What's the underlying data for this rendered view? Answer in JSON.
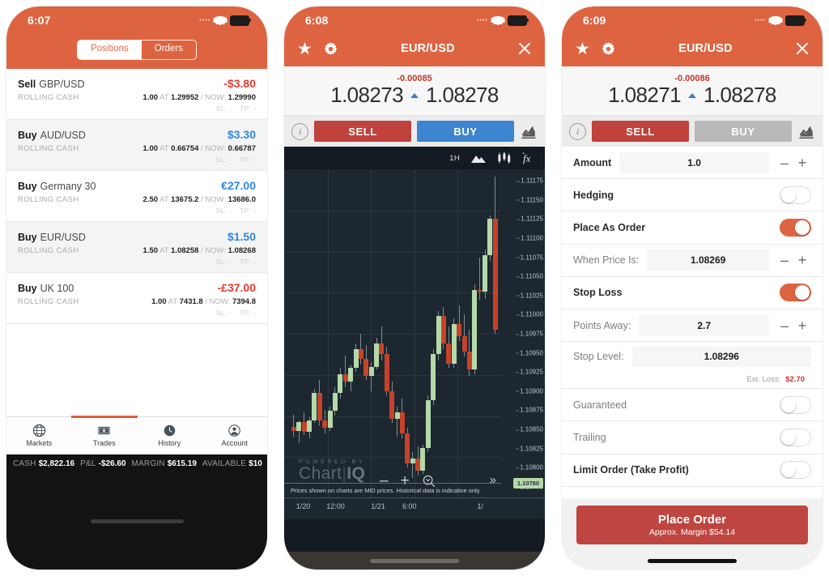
{
  "phone1": {
    "status_bar": {
      "time": "6:07",
      "dots": "••••",
      "wifi_icon": "wifi-icon",
      "battery_icon": "battery-icon"
    },
    "segmented": {
      "positions": "Positions",
      "orders": "Orders",
      "selected": "Positions"
    },
    "positions": [
      {
        "direction": "Sell",
        "instrument": "GBP/USD",
        "type": "ROLLING CASH",
        "pl": "-$3.80",
        "pl_sign": "neg",
        "size": "1.00",
        "at_label": "AT",
        "open": "1.29952",
        "now_label": "/ NOW:",
        "now": "1.29990",
        "sl": "SL: -",
        "tp": "TP: -"
      },
      {
        "direction": "Buy",
        "instrument": "AUD/USD",
        "type": "ROLLING CASH",
        "pl": "$3.30",
        "pl_sign": "pos",
        "size": "1.00",
        "at_label": "AT",
        "open": "0.66754",
        "now_label": "/ NOW:",
        "now": "0.66787",
        "sl": "SL: -",
        "tp": "TP: -"
      },
      {
        "direction": "Buy",
        "instrument": "Germany 30",
        "type": "ROLLING CASH",
        "pl": "€27.00",
        "pl_sign": "pos",
        "size": "2.50",
        "at_label": "AT",
        "open": "13675.2",
        "now_label": "/ NOW:",
        "now": "13686.0",
        "sl": "SL: -",
        "tp": "TP: -"
      },
      {
        "direction": "Buy",
        "instrument": "EUR/USD",
        "type": "ROLLING CASH",
        "pl": "$1.50",
        "pl_sign": "pos",
        "size": "1.50",
        "at_label": "AT",
        "open": "1.08258",
        "now_label": "/ NOW:",
        "now": "1.08268",
        "sl": "SL: -",
        "tp": "TP: -"
      },
      {
        "direction": "Buy",
        "instrument": "UK 100",
        "type": "ROLLING CASH",
        "pl": "-£37.00",
        "pl_sign": "neg",
        "size": "1.00",
        "at_label": "AT",
        "open": "7431.8",
        "now_label": "/ NOW:",
        "now": "7394.8",
        "sl": "SL: -",
        "tp": "TP: -"
      }
    ],
    "tabs": [
      {
        "label": "Markets",
        "icon": "globe-icon",
        "active": false
      },
      {
        "label": "Trades",
        "icon": "banknote-icon",
        "active": true
      },
      {
        "label": "History",
        "icon": "clock-icon",
        "active": false
      },
      {
        "label": "Account",
        "icon": "person-icon",
        "active": false
      }
    ],
    "account_bar": [
      {
        "key": "CASH",
        "value": "$2,822.16"
      },
      {
        "key": "P&L",
        "value": "-$26.60"
      },
      {
        "key": "MARGIN",
        "value": "$615.19"
      },
      {
        "key": "AVAILABLE",
        "value": "$10"
      }
    ]
  },
  "phone2": {
    "status_bar": {
      "time": "6:08",
      "dots": "••••",
      "wifi_icon": "wifi-icon",
      "battery_icon": "battery-icon"
    },
    "header": {
      "title": "EUR/USD",
      "star_icon": "star-icon",
      "gear_icon": "gear-icon",
      "close_icon": "close-icon"
    },
    "quote": {
      "change": "-0.00085",
      "bid": "1.08273",
      "ask": "1.08278",
      "arrow_icon": "up-arrow-icon"
    },
    "actions": {
      "info_icon": "info-icon",
      "sell": "SELL",
      "buy": "BUY",
      "buy_disabled": false,
      "chart_icon": "chart-icon"
    },
    "chart_toolbar": {
      "timeframe": "1H",
      "mountain_icon": "mountain-chart-icon",
      "candle_icon": "candlestick-icon",
      "fx_icon": "fx-studies-icon"
    },
    "chart_footer": {
      "powered_small": "POWERED BY",
      "powered_brand": "Chart",
      "powered_brand_bold": "IQ",
      "disclaimer": "Prices shown on charts are MID prices. Historical data is indicative only.",
      "zoom_out": "–",
      "zoom_in": "+",
      "zoom_reset_icon": "zoom-reset-icon",
      "forward_icon": "fast-forward-icon"
    },
    "chart_data": {
      "type": "candlestick",
      "title": "EUR/USD",
      "timeframe": "1H",
      "xlabel": "",
      "ylabel": "",
      "ylim": [
        1.1076,
        1.1119
      ],
      "grid": true,
      "legend": "none",
      "y_ticks": [
        "1.11175",
        "1.11150",
        "1.11125",
        "1.11100",
        "1.11075",
        "1.11050",
        "1.11025",
        "1.11000",
        "1.10975",
        "1.10950",
        "1.10925",
        "1.10900",
        "1.10875",
        "1.10850",
        "1.10825",
        "1.10800",
        "1.10775"
      ],
      "x_ticks": [
        "1/20",
        "12:00",
        "1/21",
        "6:00",
        "1/"
      ],
      "current_price_tag": "1.10780",
      "colors": {
        "up": "#b5d9a8",
        "down": "#c6432a",
        "background": "#1d2730",
        "grid": "#2b3740"
      },
      "candles": [
        {
          "o": 1.10853,
          "h": 1.10869,
          "l": 1.1084,
          "c": 1.10848,
          "dir": "down"
        },
        {
          "o": 1.10848,
          "h": 1.10862,
          "l": 1.10832,
          "c": 1.1086,
          "dir": "up"
        },
        {
          "o": 1.1086,
          "h": 1.10872,
          "l": 1.10843,
          "c": 1.10847,
          "dir": "down"
        },
        {
          "o": 1.10847,
          "h": 1.10866,
          "l": 1.10838,
          "c": 1.10862,
          "dir": "up"
        },
        {
          "o": 1.10862,
          "h": 1.10903,
          "l": 1.10858,
          "c": 1.10898,
          "dir": "up"
        },
        {
          "o": 1.10898,
          "h": 1.10915,
          "l": 1.10855,
          "c": 1.10862,
          "dir": "down"
        },
        {
          "o": 1.10862,
          "h": 1.10875,
          "l": 1.10845,
          "c": 1.10852,
          "dir": "down"
        },
        {
          "o": 1.10852,
          "h": 1.1088,
          "l": 1.10848,
          "c": 1.10874,
          "dir": "up"
        },
        {
          "o": 1.10874,
          "h": 1.10905,
          "l": 1.10868,
          "c": 1.10898,
          "dir": "up"
        },
        {
          "o": 1.10898,
          "h": 1.1093,
          "l": 1.1089,
          "c": 1.10922,
          "dir": "up"
        },
        {
          "o": 1.10922,
          "h": 1.10946,
          "l": 1.10905,
          "c": 1.10912,
          "dir": "down"
        },
        {
          "o": 1.10912,
          "h": 1.10935,
          "l": 1.109,
          "c": 1.1093,
          "dir": "up"
        },
        {
          "o": 1.1093,
          "h": 1.10962,
          "l": 1.10925,
          "c": 1.10955,
          "dir": "up"
        },
        {
          "o": 1.10955,
          "h": 1.10975,
          "l": 1.10935,
          "c": 1.10942,
          "dir": "down"
        },
        {
          "o": 1.10942,
          "h": 1.1096,
          "l": 1.10915,
          "c": 1.1092,
          "dir": "down"
        },
        {
          "o": 1.1092,
          "h": 1.10938,
          "l": 1.109,
          "c": 1.10932,
          "dir": "up"
        },
        {
          "o": 1.10932,
          "h": 1.1097,
          "l": 1.10928,
          "c": 1.10962,
          "dir": "up"
        },
        {
          "o": 1.10962,
          "h": 1.10985,
          "l": 1.1094,
          "c": 1.10948,
          "dir": "down"
        },
        {
          "o": 1.10948,
          "h": 1.10958,
          "l": 1.10895,
          "c": 1.109,
          "dir": "down"
        },
        {
          "o": 1.109,
          "h": 1.10912,
          "l": 1.10858,
          "c": 1.10864,
          "dir": "down"
        },
        {
          "o": 1.10864,
          "h": 1.1088,
          "l": 1.1084,
          "c": 1.10872,
          "dir": "up"
        },
        {
          "o": 1.10872,
          "h": 1.1089,
          "l": 1.10838,
          "c": 1.10845,
          "dir": "down"
        },
        {
          "o": 1.10845,
          "h": 1.10852,
          "l": 1.108,
          "c": 1.10806,
          "dir": "down"
        },
        {
          "o": 1.10806,
          "h": 1.1082,
          "l": 1.10786,
          "c": 1.10812,
          "dir": "up"
        },
        {
          "o": 1.10812,
          "h": 1.10828,
          "l": 1.1079,
          "c": 1.10796,
          "dir": "down"
        },
        {
          "o": 1.10796,
          "h": 1.1083,
          "l": 1.10792,
          "c": 1.10826,
          "dir": "up"
        },
        {
          "o": 1.10826,
          "h": 1.10895,
          "l": 1.1082,
          "c": 1.10888,
          "dir": "up"
        },
        {
          "o": 1.10888,
          "h": 1.10955,
          "l": 1.10882,
          "c": 1.10948,
          "dir": "up"
        },
        {
          "o": 1.10948,
          "h": 1.11005,
          "l": 1.1094,
          "c": 1.10998,
          "dir": "up"
        },
        {
          "o": 1.10998,
          "h": 1.1101,
          "l": 1.10955,
          "c": 1.10962,
          "dir": "down"
        },
        {
          "o": 1.10962,
          "h": 1.10985,
          "l": 1.1093,
          "c": 1.10936,
          "dir": "down"
        },
        {
          "o": 1.10936,
          "h": 1.10995,
          "l": 1.1093,
          "c": 1.10988,
          "dir": "up"
        },
        {
          "o": 1.10988,
          "h": 1.11012,
          "l": 1.10965,
          "c": 1.10972,
          "dir": "down"
        },
        {
          "o": 1.10972,
          "h": 1.11,
          "l": 1.10945,
          "c": 1.10952,
          "dir": "down"
        },
        {
          "o": 1.10952,
          "h": 1.1098,
          "l": 1.1092,
          "c": 1.10928,
          "dir": "down"
        },
        {
          "o": 1.10928,
          "h": 1.1104,
          "l": 1.10922,
          "c": 1.11032,
          "dir": "up"
        },
        {
          "o": 1.11032,
          "h": 1.11075,
          "l": 1.1102,
          "c": 1.1103,
          "dir": "down"
        },
        {
          "o": 1.1103,
          "h": 1.11085,
          "l": 1.1102,
          "c": 1.11078,
          "dir": "up"
        },
        {
          "o": 1.11078,
          "h": 1.1113,
          "l": 1.1107,
          "c": 1.11125,
          "dir": "up"
        },
        {
          "o": 1.11125,
          "h": 1.1118,
          "l": 1.10975,
          "c": 1.1098,
          "dir": "down"
        }
      ]
    }
  },
  "phone3": {
    "status_bar": {
      "time": "6:09",
      "dots": "••••",
      "wifi_icon": "wifi-icon",
      "battery_icon": "battery-icon"
    },
    "header": {
      "title": "EUR/USD",
      "star_icon": "star-icon",
      "gear_icon": "gear-icon",
      "close_icon": "close-icon"
    },
    "quote": {
      "change": "-0.00086",
      "bid": "1.08271",
      "ask": "1.08278",
      "arrow_icon": "up-arrow-icon"
    },
    "actions": {
      "info_icon": "info-icon",
      "sell": "SELL",
      "buy": "BUY",
      "buy_disabled": true,
      "chart_icon": "chart-icon"
    },
    "form": {
      "amount": {
        "label": "Amount",
        "value": "1.0",
        "minus": "–",
        "plus": "+"
      },
      "hedging": {
        "label": "Hedging",
        "state": "off"
      },
      "place_as_order": {
        "label": "Place As Order",
        "state": "on"
      },
      "when_price_is": {
        "label": "When Price Is:",
        "value": "1.08269",
        "minus": "–",
        "plus": "+"
      },
      "stop_loss": {
        "label": "Stop Loss",
        "state": "on"
      },
      "points_away": {
        "label": "Points Away:",
        "value": "2.7",
        "minus": "–",
        "plus": "+"
      },
      "stop_level": {
        "label": "Stop Level:",
        "value": "1.08296"
      },
      "est_loss": {
        "label": "Est. Loss:",
        "value": "$2.70"
      },
      "guaranteed": {
        "label": "Guaranteed",
        "state": "off"
      },
      "trailing": {
        "label": "Trailing",
        "state": "off"
      },
      "limit_order": {
        "label": "Limit Order (Take Profit)",
        "state": "off"
      }
    },
    "place_order": {
      "title": "Place Order",
      "subtitle": "Approx. Margin $54.14"
    }
  },
  "colors": {
    "brand_orange": "#de6441",
    "sell_red": "#c0423c",
    "buy_blue": "#3d85d0",
    "profit_blue": "#2f86dd",
    "loss_red": "#e03b2f",
    "chart_bg": "#1d2730",
    "candle_up": "#b5d9a8",
    "candle_down": "#c6432a"
  }
}
